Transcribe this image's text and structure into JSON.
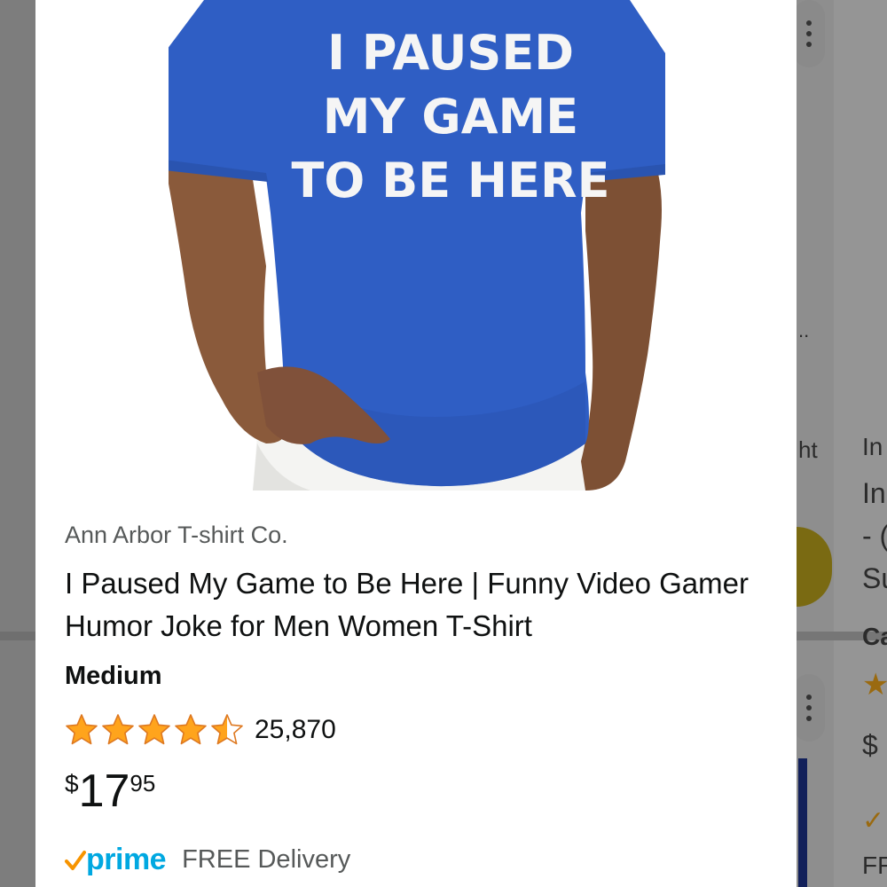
{
  "product": {
    "brand": "Ann Arbor T-shirt Co.",
    "title": "I Paused My Game to Be Here | Funny Video Gamer Humor Joke for Men Women T-Shirt",
    "size": "Medium",
    "rating": 4.5,
    "rating_max": 5,
    "review_count": "25,870",
    "price": {
      "symbol": "$",
      "whole": "17",
      "fraction": "95"
    },
    "prime_label": "prime",
    "delivery": "FREE Delivery",
    "shirt_print": [
      "I PAUSED",
      "MY GAME",
      "TO BE HERE"
    ],
    "image_icon": "tshirt-product-photo"
  },
  "background_fragments": {
    "ellipsis": "..",
    "word_end": "ht",
    "right_top_label": "In",
    "right_title_line1": "In",
    "right_title_line2": "- (",
    "right_title_line3": "Su",
    "right_bold": "Ca",
    "right_price": "$",
    "right_delivery": "FF"
  },
  "colors": {
    "star": "#ffa41c",
    "prime": "#00a8e1",
    "text": "#0f1111",
    "muted": "#565959",
    "shirt": "#2f5ec4"
  }
}
